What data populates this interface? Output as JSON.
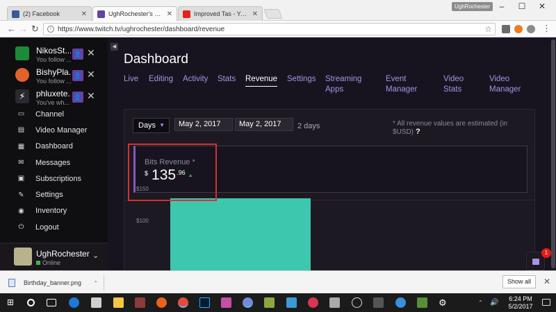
{
  "browser": {
    "tabs": [
      {
        "title": "(2) Facebook",
        "active": false,
        "color": "#3b5998"
      },
      {
        "title": "UghRochester's Dashboa",
        "active": true,
        "color": "#6441a4"
      },
      {
        "title": "Improved Tas - YouTube",
        "active": false,
        "color": "#e62117"
      }
    ],
    "profile": "UghRochester",
    "url": "https://www.twitch.tv/ughrochester/dashboard/revenue"
  },
  "sidebar": {
    "friends": [
      {
        "name": "NikosSt...",
        "sub": "You follow ...",
        "color": "#1d8a3a"
      },
      {
        "name": "BishyPla...",
        "sub": "You follow ...",
        "color": "#e0632a"
      },
      {
        "name": "phluxete...",
        "sub": "You've wh...",
        "color": "#2b2830"
      }
    ],
    "nav": [
      {
        "label": "Channel",
        "icon": "channel-icon",
        "glyph": "▭"
      },
      {
        "label": "Video Manager",
        "icon": "video-manager-icon",
        "glyph": "▤"
      },
      {
        "label": "Dashboard",
        "icon": "dashboard-icon",
        "glyph": "▦"
      },
      {
        "label": "Messages",
        "icon": "messages-icon",
        "glyph": "✉"
      },
      {
        "label": "Subscriptions",
        "icon": "subscriptions-icon",
        "glyph": "▣"
      },
      {
        "label": "Settings",
        "icon": "wrench-icon",
        "glyph": "✎"
      },
      {
        "label": "Inventory",
        "icon": "inventory-icon",
        "glyph": "◉"
      },
      {
        "label": "Logout",
        "icon": "logout-icon",
        "glyph": "⏻"
      }
    ],
    "user": {
      "name": "UghRochester",
      "status": "Online"
    }
  },
  "dashboard": {
    "title": "Dashboard",
    "tabs": [
      {
        "label": "Live"
      },
      {
        "label": "Editing"
      },
      {
        "label": "Activity"
      },
      {
        "label": "Stats"
      },
      {
        "label": "Revenue",
        "active": true
      },
      {
        "label": "Settings"
      },
      {
        "label": "Streaming\nApps"
      },
      {
        "label": "Event\nManager"
      },
      {
        "label": "Video\nStats"
      },
      {
        "label": "Video\nManager"
      }
    ],
    "period_select": "Days",
    "start_date": "May 2, 2017",
    "end_date": "May 2, 2017",
    "days_count": "2 days",
    "estimate_note": "* All revenue values are estimated (in $USD)",
    "estimate_help": "?",
    "bits": {
      "label": "Bits Revenue *",
      "currency": "$",
      "integer": "135",
      "decimal": ".96"
    }
  },
  "chart_data": {
    "type": "bar",
    "y_ticks": [
      "$150",
      "$100"
    ],
    "values": [
      135.96
    ],
    "ylim": [
      0,
      150
    ],
    "bar_color": "#3ec7af"
  },
  "chat_badge": "1",
  "downloads": {
    "file": "Birthday_banner.png",
    "show_all": "Show all"
  },
  "taskbar": {
    "time": "6:24 PM",
    "date": "5/2/2017"
  }
}
